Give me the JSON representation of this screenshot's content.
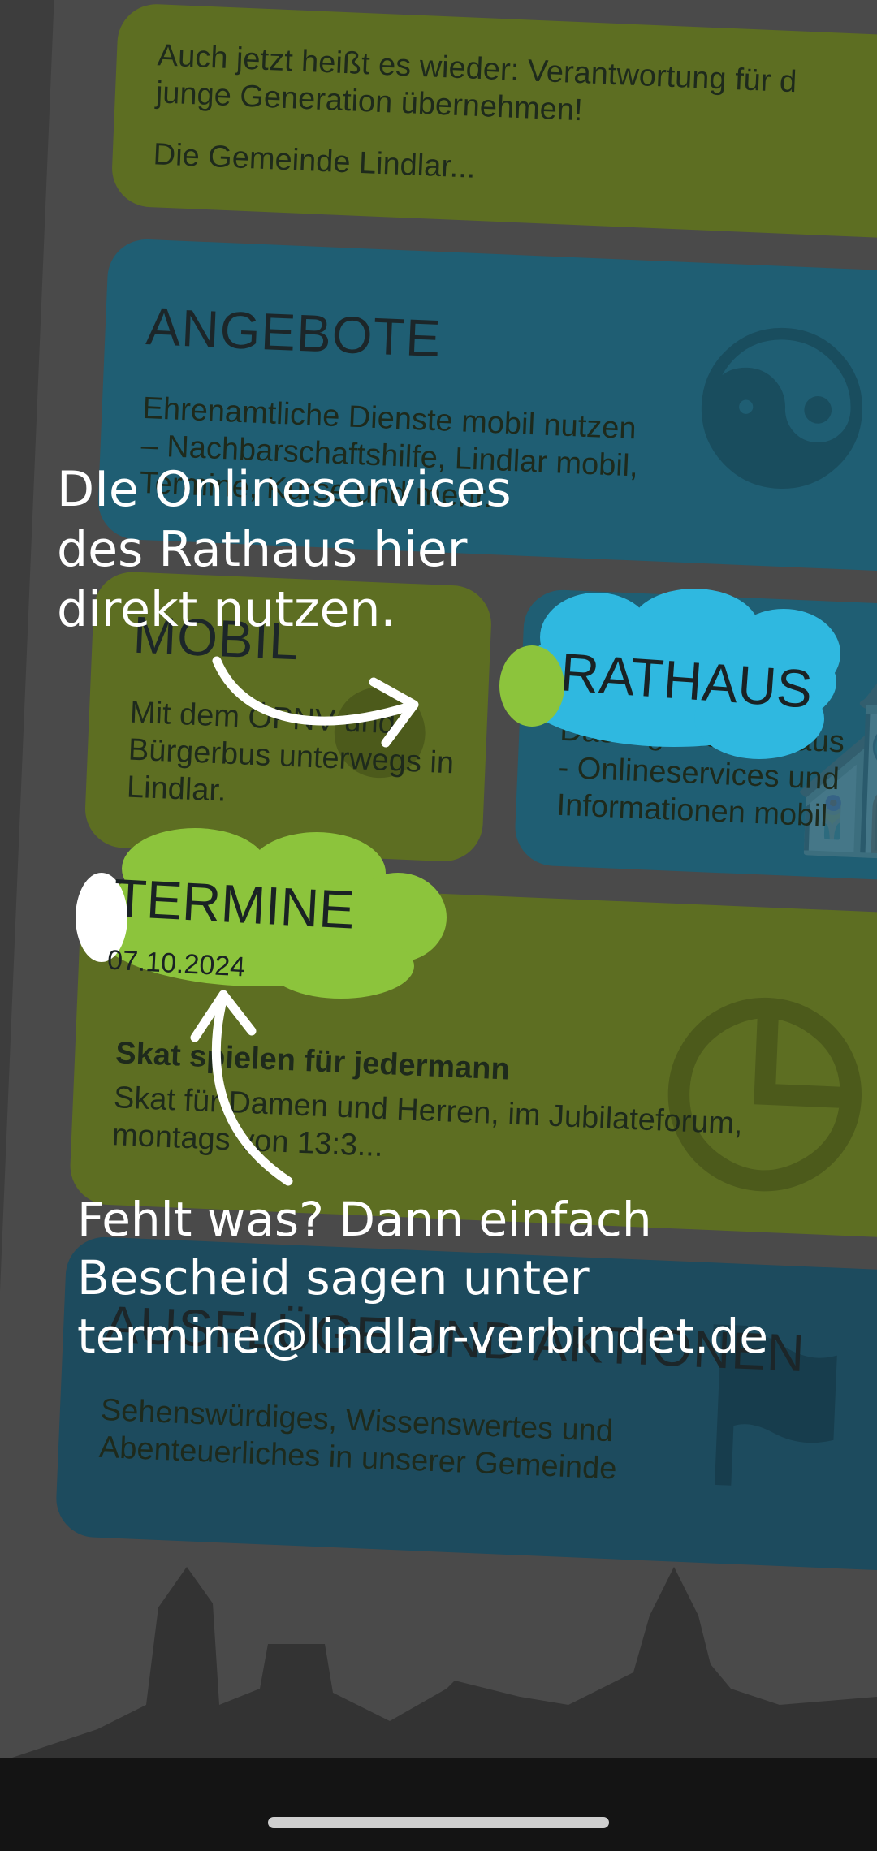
{
  "cards": {
    "intro": {
      "text_line1": "Auch jetzt heißt es wieder: Verantwortung für d",
      "text_line2": "junge Generation übernehmen!",
      "text_line3": "Die Gemeinde Lindlar..."
    },
    "angebote": {
      "title": "ANGEBOTE",
      "text_line1": "Ehrenamtliche Dienste mobil nutzen",
      "text_line2": "– Nachbarschaftshilfe, Lindlar mobil,",
      "text_line3": "Termine, Kurse und mehr."
    },
    "mobil": {
      "title": "MOBIL",
      "text_line1": "Mit dem ÖPNV und",
      "text_line2": "Bürgerbus unterwegs in",
      "text_line3": "Lindlar."
    },
    "rathaus": {
      "title": "RATHAUS",
      "text_line1": "Das digitale Rathaus",
      "text_line2": "- Onlineservices und",
      "text_line3": "Informationen mobil"
    },
    "termine": {
      "title": "TERMINE",
      "date": "07.10.2024",
      "event_title": "Skat spielen für jedermann",
      "text_line1": "Skat für Damen und Herren, im Jubilateforum,",
      "text_line2": "montags von 13:3..."
    },
    "ausfluege": {
      "title": "AUSFLÜGE UND AKTIONEN",
      "text_line1": "Sehenswürdiges, Wissenswertes und",
      "text_line2": "Abenteuerliches in unserer Gemeinde"
    }
  },
  "callouts": {
    "rathaus_line1": "DIe Onlineservices",
    "rathaus_line2": "des Rathaus hier",
    "rathaus_line3": "direkt nutzen.",
    "termine_line1": "Fehlt was? Dann einfach",
    "termine_line2": "Bescheid sagen unter",
    "termine_line3": "termine@lindlar-verbindet.de"
  },
  "colors": {
    "green_card": "#5d6e22",
    "blue_card": "#1f5e73",
    "rathaus_cloud": "#2fb8e0",
    "termine_cloud": "#8cc43c"
  },
  "icons": {
    "status": "wifi-icon",
    "mobil_deco": "location-pin-icon",
    "rathaus_deco": "town-hall-icon",
    "termine_deco": "clock-icon",
    "ausfluege_deco": "hiking-icon"
  }
}
